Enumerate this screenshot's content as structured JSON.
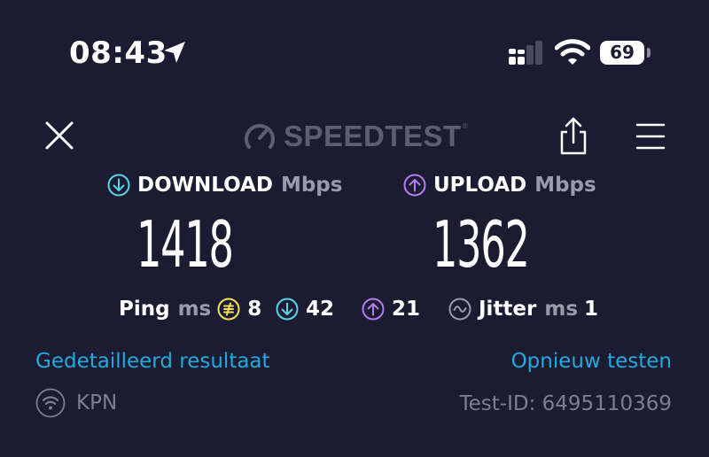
{
  "status_bar": {
    "time": "08:43",
    "battery_level": "69"
  },
  "header": {
    "brand": "SPEEDTEST",
    "brand_mark": "®"
  },
  "download": {
    "label": "DOWNLOAD",
    "unit": "Mbps",
    "value": "1418",
    "color": "#58d3e6"
  },
  "upload": {
    "label": "UPLOAD",
    "unit": "Mbps",
    "value": "1362",
    "color": "#b57cf0"
  },
  "stats": {
    "ping_label": "Ping",
    "ping_unit": "ms",
    "ping_idle": "8",
    "ping_download": "42",
    "ping_upload": "21",
    "jitter_label": "Jitter",
    "jitter_unit": "ms",
    "jitter_value": "1",
    "idle_color": "#f5e15a"
  },
  "links": {
    "detailed_result": "Gedetailleerd resultaat",
    "retest": "Opnieuw testen",
    "color": "#23a9e0"
  },
  "footer": {
    "provider": "KPN",
    "test_id": "Test-ID: 6495110369"
  },
  "icons": {
    "location": "location-arrow-icon",
    "signal": "cellular-signal-icon",
    "wifi": "wifi-icon",
    "close": "close-icon",
    "share": "share-icon",
    "menu": "hamburger-menu-icon"
  }
}
